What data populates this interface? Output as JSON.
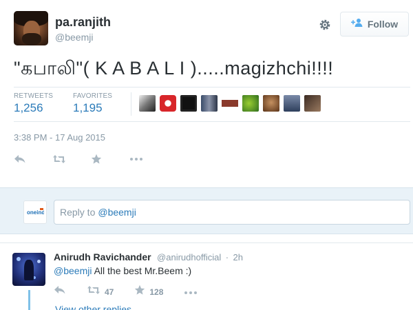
{
  "tweet": {
    "author_name": "pa.ranjith",
    "author_handle": "@beemji",
    "follow_label": "Follow",
    "text": "\"கபாலி\"( K A B A L I ).....magizhchi!!!!",
    "retweets_label": "RETWEETS",
    "retweets_count": "1,256",
    "favorites_label": "FAVORITES",
    "favorites_count": "1,195",
    "timestamp": "3:38 PM - 17 Aug 2015",
    "favoriters": [
      "fav-avatar-1",
      "fav-avatar-2",
      "fav-avatar-3",
      "fav-avatar-4",
      "fav-avatar-5",
      "fav-avatar-6",
      "fav-avatar-7",
      "fav-avatar-8",
      "fav-avatar-9"
    ]
  },
  "reply_box": {
    "placeholder_prefix": "Reply to",
    "mention": "@beemji"
  },
  "reply": {
    "name": "Anirudh Ravichander",
    "handle": "@anirudhofficial",
    "separator": "·",
    "time": "2h",
    "mention": "@beemji",
    "text": " All the best Mr.Beem :)",
    "retweet_count": "47",
    "favorite_count": "128",
    "view_more": "View other replies"
  },
  "colors": {
    "link": "#2b7bb9",
    "muted": "#8899a6",
    "reply_bg": "#e9f2f8"
  }
}
